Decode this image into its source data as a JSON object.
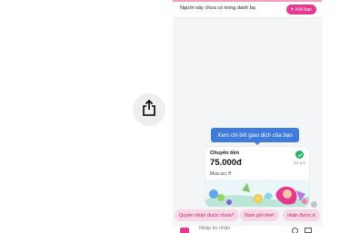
{
  "banner": {
    "text": "Người này chưa có trong danh bạ",
    "add_friend_label": "Kết bạn"
  },
  "tooltip": {
    "text": "Xem chi tiết giao dịch của bạn"
  },
  "transfer_card": {
    "title": "Chuyển tiền",
    "amount": "75.000đ",
    "status": "Đã gửi",
    "note": "Mua acc ff"
  },
  "quick_replies": [
    "Quyền nhận được chưa?",
    "Nam gửi nhé!",
    "nhận được tr"
  ],
  "composer": {
    "placeholder": "Nhập tin nhắn"
  },
  "colors": {
    "accent": "#e7388f",
    "tooltip": "#3d7bdc",
    "success": "#20b55c"
  },
  "icons": [
    "share-icon",
    "plus-icon",
    "check-icon",
    "sticker-icon",
    "emoji-icon",
    "image-icon"
  ]
}
